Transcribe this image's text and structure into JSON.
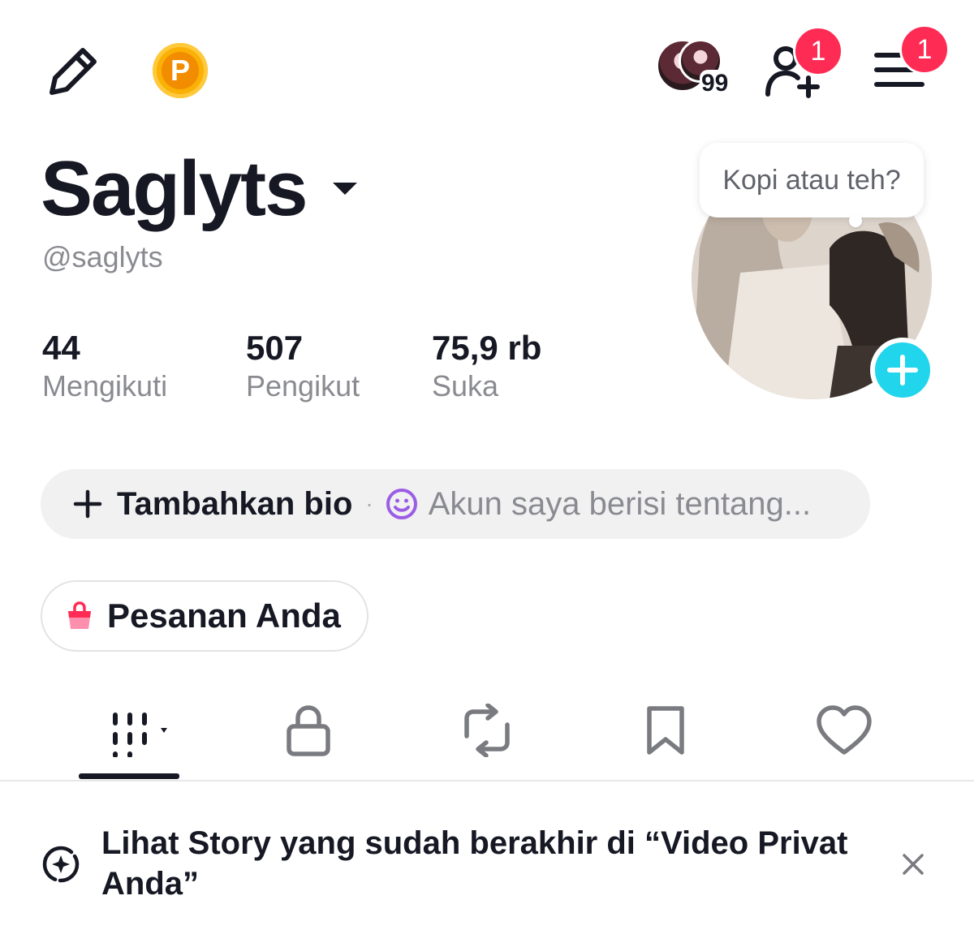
{
  "header": {
    "edit_icon": "pencil-icon",
    "coin_label": "P",
    "friends_count": "99",
    "add_friend_badge": "1",
    "menu_badge": "1"
  },
  "profile": {
    "name": "Saglyts",
    "handle": "@saglyts",
    "stats": [
      {
        "value": "44",
        "label": "Mengikuti"
      },
      {
        "value": "507",
        "label": "Pengikut"
      },
      {
        "value": "75,9 rb",
        "label": "Suka"
      }
    ],
    "bubble": "Kopi atau teh?"
  },
  "bio": {
    "add_label": "Tambahkan bio",
    "hint": "Akun saya berisi tentang..."
  },
  "orders": {
    "label": "Pesanan Anda"
  },
  "tabs": [
    {
      "icon": "grid-icon",
      "active": true
    },
    {
      "icon": "lock-icon"
    },
    {
      "icon": "repost-icon"
    },
    {
      "icon": "bookmark-icon"
    },
    {
      "icon": "heart-icon"
    }
  ],
  "notice": {
    "text": "Lihat Story yang sudah berakhir di “Video Privat Anda”"
  },
  "colors": {
    "accent_red": "#FE2C55",
    "accent_cyan": "#20D5EC",
    "coin": "#FAB005",
    "muted": "#8a8b91"
  }
}
